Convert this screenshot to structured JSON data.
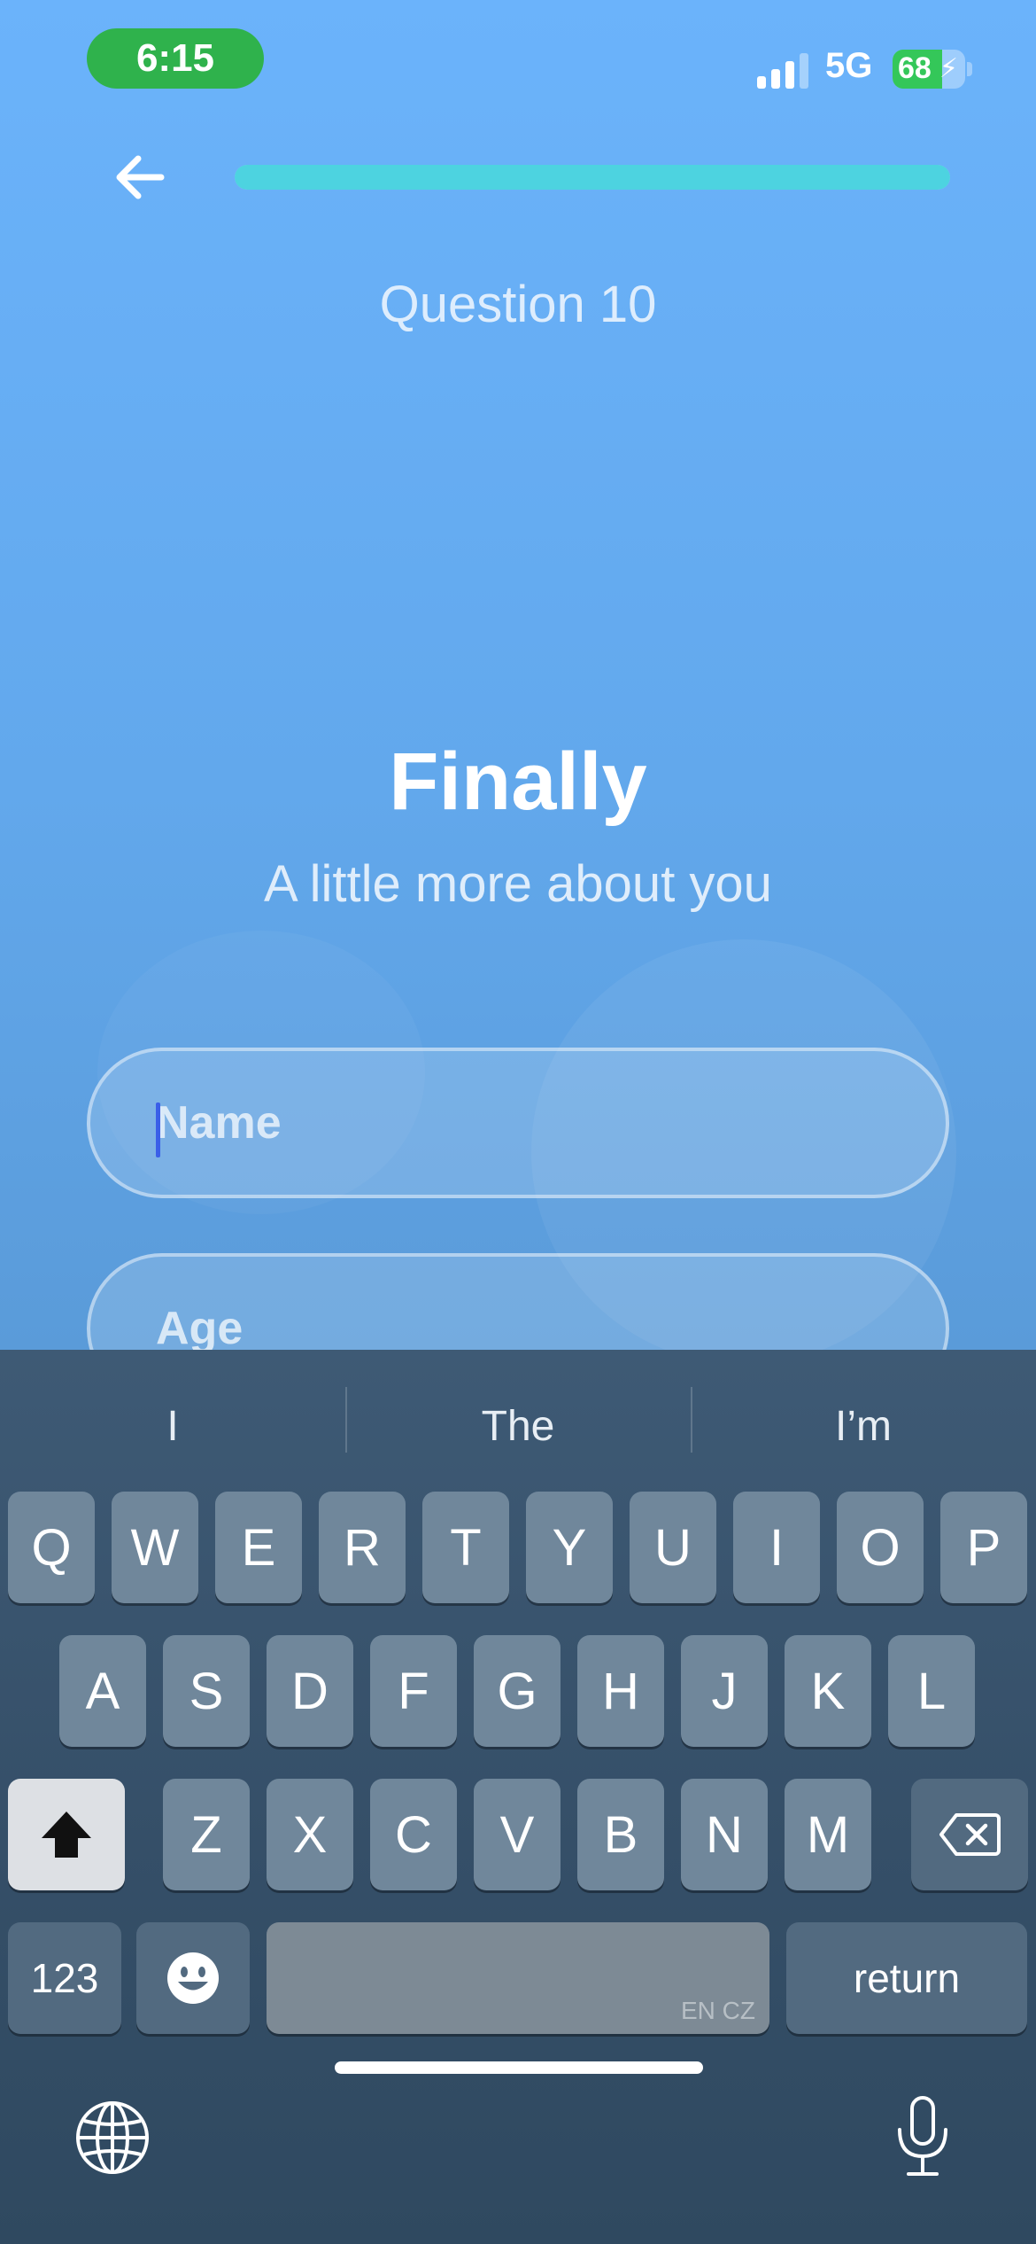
{
  "status_bar": {
    "time": "6:15",
    "network": "5G",
    "battery": "68",
    "battery_level": 0.68
  },
  "header": {
    "progress": 1.0,
    "question_label": "Question 10"
  },
  "main": {
    "title": "Finally",
    "subtitle": "A little more about you"
  },
  "form": {
    "name_placeholder": "Name",
    "name_value": "",
    "age_placeholder": "Age",
    "age_value": ""
  },
  "keyboard": {
    "suggestions": [
      "I",
      "The",
      "I’m"
    ],
    "row1": [
      "Q",
      "W",
      "E",
      "R",
      "T",
      "Y",
      "U",
      "I",
      "O",
      "P"
    ],
    "row2": [
      "A",
      "S",
      "D",
      "F",
      "G",
      "H",
      "J",
      "K",
      "L"
    ],
    "row3": [
      "Z",
      "X",
      "C",
      "V",
      "B",
      "N",
      "M"
    ],
    "numbers_label": "123",
    "space_sublabel": "EN CZ",
    "return_label": "return"
  },
  "colors": {
    "accent": "#4dd3e0",
    "status_green": "#2fb24c",
    "caret": "#3a5fe8"
  }
}
